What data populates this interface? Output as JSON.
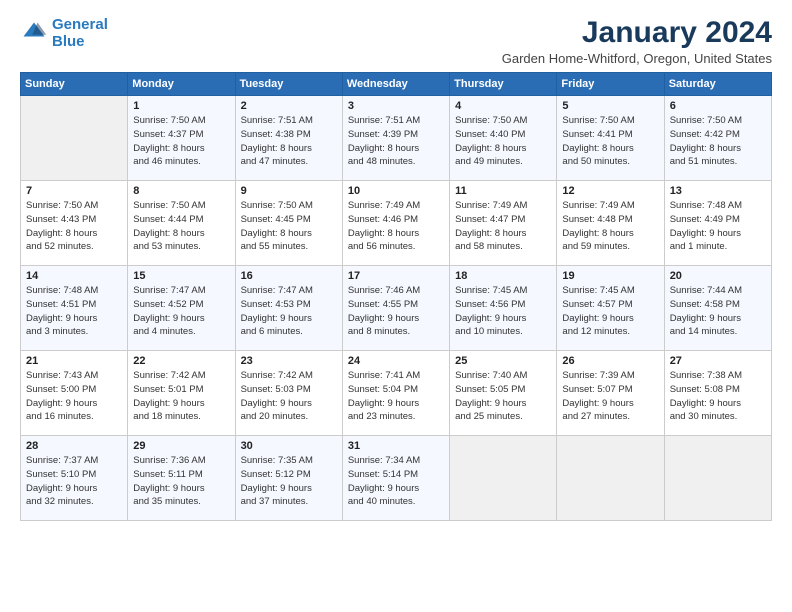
{
  "logo": {
    "line1": "General",
    "line2": "Blue"
  },
  "header": {
    "title": "January 2024",
    "subtitle": "Garden Home-Whitford, Oregon, United States"
  },
  "weekdays": [
    "Sunday",
    "Monday",
    "Tuesday",
    "Wednesday",
    "Thursday",
    "Friday",
    "Saturday"
  ],
  "weeks": [
    [
      {
        "day": "",
        "info": ""
      },
      {
        "day": "1",
        "info": "Sunrise: 7:50 AM\nSunset: 4:37 PM\nDaylight: 8 hours\nand 46 minutes."
      },
      {
        "day": "2",
        "info": "Sunrise: 7:51 AM\nSunset: 4:38 PM\nDaylight: 8 hours\nand 47 minutes."
      },
      {
        "day": "3",
        "info": "Sunrise: 7:51 AM\nSunset: 4:39 PM\nDaylight: 8 hours\nand 48 minutes."
      },
      {
        "day": "4",
        "info": "Sunrise: 7:50 AM\nSunset: 4:40 PM\nDaylight: 8 hours\nand 49 minutes."
      },
      {
        "day": "5",
        "info": "Sunrise: 7:50 AM\nSunset: 4:41 PM\nDaylight: 8 hours\nand 50 minutes."
      },
      {
        "day": "6",
        "info": "Sunrise: 7:50 AM\nSunset: 4:42 PM\nDaylight: 8 hours\nand 51 minutes."
      }
    ],
    [
      {
        "day": "7",
        "info": "Sunrise: 7:50 AM\nSunset: 4:43 PM\nDaylight: 8 hours\nand 52 minutes."
      },
      {
        "day": "8",
        "info": "Sunrise: 7:50 AM\nSunset: 4:44 PM\nDaylight: 8 hours\nand 53 minutes."
      },
      {
        "day": "9",
        "info": "Sunrise: 7:50 AM\nSunset: 4:45 PM\nDaylight: 8 hours\nand 55 minutes."
      },
      {
        "day": "10",
        "info": "Sunrise: 7:49 AM\nSunset: 4:46 PM\nDaylight: 8 hours\nand 56 minutes."
      },
      {
        "day": "11",
        "info": "Sunrise: 7:49 AM\nSunset: 4:47 PM\nDaylight: 8 hours\nand 58 minutes."
      },
      {
        "day": "12",
        "info": "Sunrise: 7:49 AM\nSunset: 4:48 PM\nDaylight: 8 hours\nand 59 minutes."
      },
      {
        "day": "13",
        "info": "Sunrise: 7:48 AM\nSunset: 4:49 PM\nDaylight: 9 hours\nand 1 minute."
      }
    ],
    [
      {
        "day": "14",
        "info": "Sunrise: 7:48 AM\nSunset: 4:51 PM\nDaylight: 9 hours\nand 3 minutes."
      },
      {
        "day": "15",
        "info": "Sunrise: 7:47 AM\nSunset: 4:52 PM\nDaylight: 9 hours\nand 4 minutes."
      },
      {
        "day": "16",
        "info": "Sunrise: 7:47 AM\nSunset: 4:53 PM\nDaylight: 9 hours\nand 6 minutes."
      },
      {
        "day": "17",
        "info": "Sunrise: 7:46 AM\nSunset: 4:55 PM\nDaylight: 9 hours\nand 8 minutes."
      },
      {
        "day": "18",
        "info": "Sunrise: 7:45 AM\nSunset: 4:56 PM\nDaylight: 9 hours\nand 10 minutes."
      },
      {
        "day": "19",
        "info": "Sunrise: 7:45 AM\nSunset: 4:57 PM\nDaylight: 9 hours\nand 12 minutes."
      },
      {
        "day": "20",
        "info": "Sunrise: 7:44 AM\nSunset: 4:58 PM\nDaylight: 9 hours\nand 14 minutes."
      }
    ],
    [
      {
        "day": "21",
        "info": "Sunrise: 7:43 AM\nSunset: 5:00 PM\nDaylight: 9 hours\nand 16 minutes."
      },
      {
        "day": "22",
        "info": "Sunrise: 7:42 AM\nSunset: 5:01 PM\nDaylight: 9 hours\nand 18 minutes."
      },
      {
        "day": "23",
        "info": "Sunrise: 7:42 AM\nSunset: 5:03 PM\nDaylight: 9 hours\nand 20 minutes."
      },
      {
        "day": "24",
        "info": "Sunrise: 7:41 AM\nSunset: 5:04 PM\nDaylight: 9 hours\nand 23 minutes."
      },
      {
        "day": "25",
        "info": "Sunrise: 7:40 AM\nSunset: 5:05 PM\nDaylight: 9 hours\nand 25 minutes."
      },
      {
        "day": "26",
        "info": "Sunrise: 7:39 AM\nSunset: 5:07 PM\nDaylight: 9 hours\nand 27 minutes."
      },
      {
        "day": "27",
        "info": "Sunrise: 7:38 AM\nSunset: 5:08 PM\nDaylight: 9 hours\nand 30 minutes."
      }
    ],
    [
      {
        "day": "28",
        "info": "Sunrise: 7:37 AM\nSunset: 5:10 PM\nDaylight: 9 hours\nand 32 minutes."
      },
      {
        "day": "29",
        "info": "Sunrise: 7:36 AM\nSunset: 5:11 PM\nDaylight: 9 hours\nand 35 minutes."
      },
      {
        "day": "30",
        "info": "Sunrise: 7:35 AM\nSunset: 5:12 PM\nDaylight: 9 hours\nand 37 minutes."
      },
      {
        "day": "31",
        "info": "Sunrise: 7:34 AM\nSunset: 5:14 PM\nDaylight: 9 hours\nand 40 minutes."
      },
      {
        "day": "",
        "info": ""
      },
      {
        "day": "",
        "info": ""
      },
      {
        "day": "",
        "info": ""
      }
    ]
  ]
}
